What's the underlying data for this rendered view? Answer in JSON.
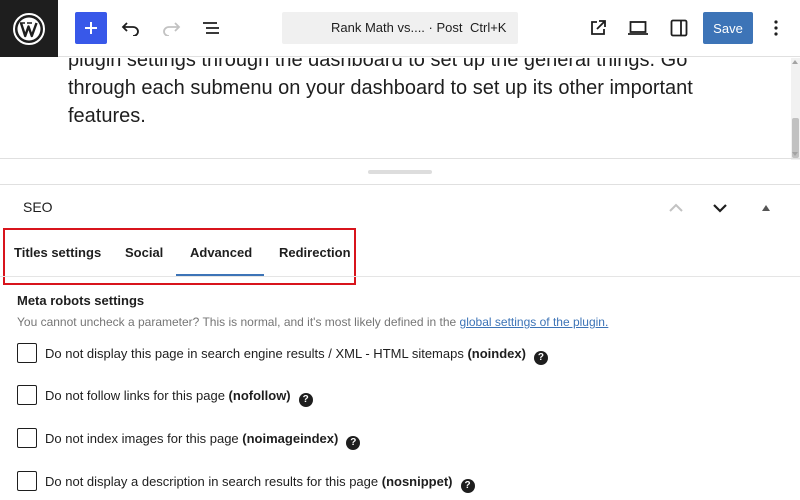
{
  "toolbar": {
    "doc_title": "Rank Math vs.... · Post",
    "shortcut": "Ctrl+K",
    "save_label": "Save",
    "accent_color": "#3858e9"
  },
  "editor": {
    "paragraph": "plugin settings through the dashboard to set up the general things. Go through each submenu on your dashboard to set up its other important features."
  },
  "seo_panel": {
    "title": "SEO",
    "tabs": [
      {
        "label": "Titles settings",
        "active": false
      },
      {
        "label": "Social",
        "active": false
      },
      {
        "label": "Advanced",
        "active": true
      },
      {
        "label": "Redirection",
        "active": false
      }
    ],
    "highlight_color": "#d8141c",
    "meta_robots": {
      "heading": "Meta robots settings",
      "description": "You cannot uncheck a parameter? This is normal, and it's most likely defined in the ",
      "link_text": "global settings of the plugin.",
      "options": [
        {
          "text": "Do not display this page in search engine results / XML - HTML sitemaps ",
          "key": "(noindex)",
          "checked": false
        },
        {
          "text": "Do not follow links for this page ",
          "key": "(nofollow)",
          "checked": false
        },
        {
          "text": "Do not index images for this page ",
          "key": "(noimageindex)",
          "checked": false
        },
        {
          "text": "Do not display a description in search results for this page ",
          "key": "(nosnippet)",
          "checked": false
        }
      ]
    }
  }
}
